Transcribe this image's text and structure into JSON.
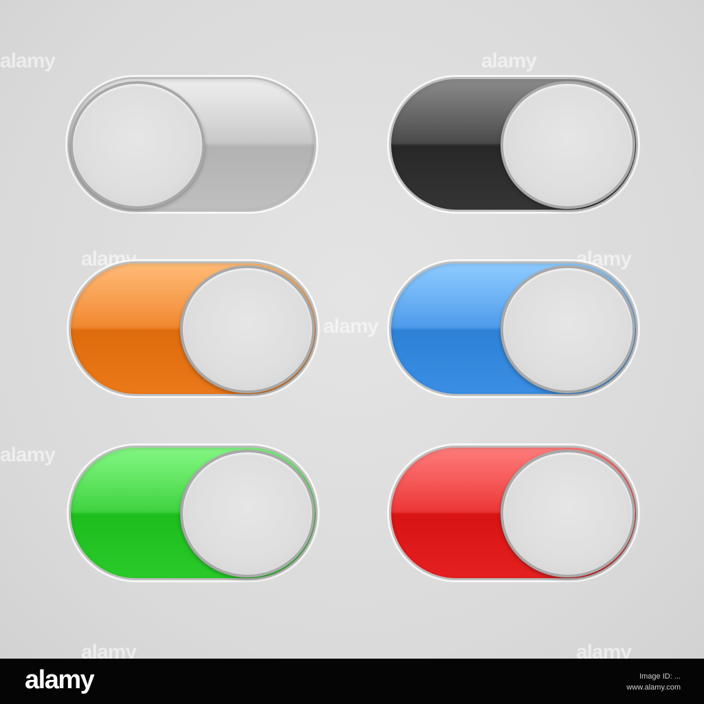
{
  "toggles": [
    {
      "label": "gray-toggle",
      "state": "off",
      "color": "#c4c4c4"
    },
    {
      "label": "black-toggle",
      "state": "on",
      "color": "#3a3a3a"
    },
    {
      "label": "orange-toggle",
      "state": "on",
      "color": "#f07d1e"
    },
    {
      "label": "blue-toggle",
      "state": "on",
      "color": "#3f93e8"
    },
    {
      "label": "green-toggle",
      "state": "on",
      "color": "#2fcf2f"
    },
    {
      "label": "red-toggle",
      "state": "on",
      "color": "#ea2525"
    }
  ],
  "watermark": {
    "text": "alamy"
  },
  "footer": {
    "brand": "alamy",
    "image_id": "Image ID: ...",
    "site": "www.alamy.com"
  }
}
